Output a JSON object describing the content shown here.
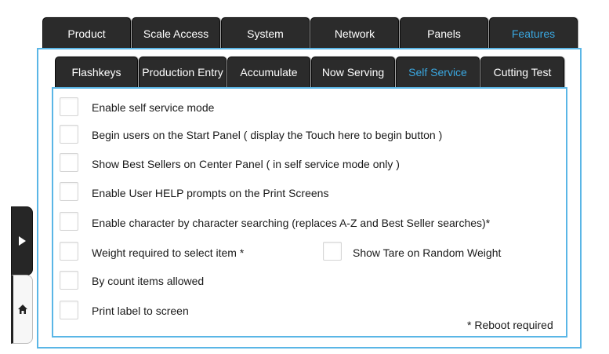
{
  "top_tabs": [
    {
      "label": "Product",
      "active": false
    },
    {
      "label": "Scale Access",
      "active": false
    },
    {
      "label": "System",
      "active": false
    },
    {
      "label": "Network",
      "active": false
    },
    {
      "label": "Panels",
      "active": false
    },
    {
      "label": "Features",
      "active": true
    }
  ],
  "sub_tabs": [
    {
      "label": "Flashkeys",
      "active": false
    },
    {
      "label": "Production Entry",
      "active": false
    },
    {
      "label": "Accumulate",
      "active": false
    },
    {
      "label": "Now Serving",
      "active": false
    },
    {
      "label": "Self Service",
      "active": true
    },
    {
      "label": "Cutting Test",
      "active": false
    }
  ],
  "options": [
    {
      "label": "Enable self service mode",
      "checked": false
    },
    {
      "label": "Begin users on the Start Panel ( display the Touch here to begin button )",
      "checked": false
    },
    {
      "label": "Show Best Sellers on Center Panel ( in self service mode only )",
      "checked": false
    },
    {
      "label": "Enable User HELP prompts on the Print Screens",
      "checked": false
    },
    {
      "label": "Enable character by character searching (replaces A-Z and Best Seller searches)*",
      "checked": false
    },
    {
      "label": "Weight required to select item *",
      "checked": false
    },
    {
      "label": "Show Tare on Random Weight",
      "checked": false
    },
    {
      "label": "By count items allowed",
      "checked": false
    },
    {
      "label": "Print label to screen",
      "checked": false
    }
  ],
  "footer_note": "* Reboot required",
  "side_buttons": {
    "expand_icon": "chevron-right-icon",
    "home_icon": "home-icon"
  },
  "colors": {
    "accent": "#3aa7e0",
    "panel_border": "#5ab6e6",
    "tab_bg": "#2b2b2b"
  }
}
